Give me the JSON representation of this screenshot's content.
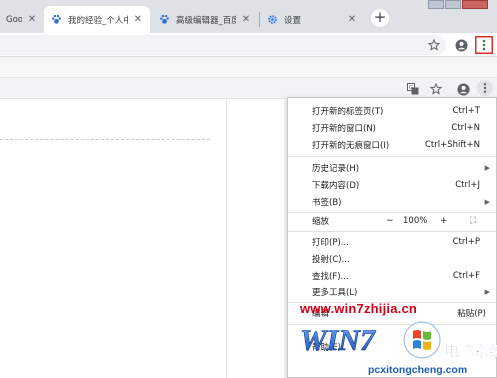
{
  "browser": {
    "tabs": [
      {
        "title": "Googl",
        "favicon": "google-favicon",
        "active": false
      },
      {
        "title": "我的经验_个人中",
        "favicon": "paw-favicon",
        "active": true
      },
      {
        "title": "高级编辑器_百度",
        "favicon": "paw-favicon",
        "active": false
      },
      {
        "title": "设置",
        "favicon": "gear-icon",
        "active": false
      }
    ],
    "close_glyph": "✕",
    "new_tab_glyph": "+",
    "accent_color": "#d93025"
  },
  "menu": {
    "items": [
      {
        "label": "打开新的标签页(T)",
        "shortcut": "Ctrl+T"
      },
      {
        "label": "打开新的窗口(N)",
        "shortcut": "Ctrl+N"
      },
      {
        "label": "打开新的无痕窗口(I)",
        "shortcut": "Ctrl+Shift+N"
      },
      {
        "label": "历史记录(H)",
        "submenu": true
      },
      {
        "label": "下载内容(D)",
        "shortcut": "Ctrl+J"
      },
      {
        "label": "书签(B)",
        "submenu": true
      },
      {
        "label": "缩放",
        "zoom_minus": "−",
        "zoom_value": "100%",
        "zoom_plus": "+",
        "fullscreen_glyph": "⛶"
      },
      {
        "label": "打印(P)...",
        "shortcut": "Ctrl+P"
      },
      {
        "label": "投射(C)..."
      },
      {
        "label": "查找(F)...",
        "shortcut": "Ctrl+F"
      },
      {
        "label": "更多工具(L)",
        "submenu": true
      },
      {
        "label": "编辑",
        "edit_action": "粘贴(P)"
      },
      {
        "label": "帮助(E)"
      }
    ]
  },
  "watermark": {
    "url": "www.win7zhijia.cn",
    "logo_text": "WIN7",
    "cn_text": "电脑系统城",
    "domain": "pcxitongcheng.com"
  }
}
